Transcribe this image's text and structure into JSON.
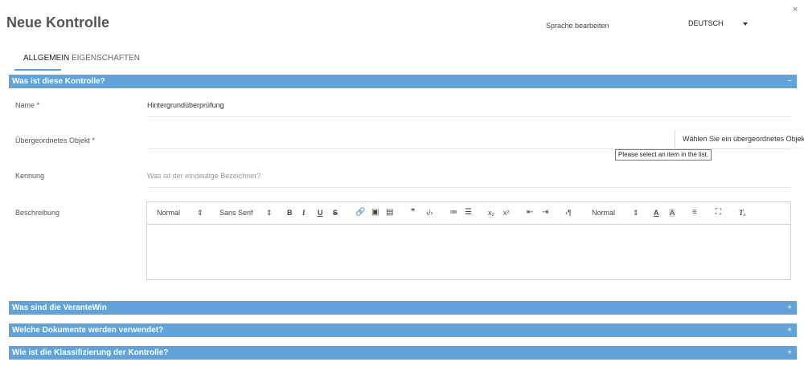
{
  "dialog": {
    "title": "Neue Kontrolle",
    "close_glyph": "×",
    "language_label": "Sprache bearbeiten",
    "language_value": "DEUTSCH"
  },
  "tabs": [
    {
      "label": "ALLGEMEIN",
      "active": true
    },
    {
      "label": "EIGENSCHAFTEN",
      "active": false
    }
  ],
  "accent_color": "#61a3d8",
  "sections": [
    {
      "title": "Was ist diese Kontrolle?",
      "toggle": "−",
      "expanded": true
    },
    {
      "title": "Was sind die VeranteWin",
      "toggle": "+",
      "expanded": false
    },
    {
      "title": "Welche Dokumente werden verwendet?",
      "toggle": "+",
      "expanded": false
    },
    {
      "title": "Wie ist die Klassifizierung der Kontrolle?",
      "toggle": "+",
      "expanded": false
    }
  ],
  "fields": {
    "name": {
      "label": "Name *",
      "value": "Hintergrundüberprüfung"
    },
    "parent": {
      "label": "Übergeordnetes Objekt *",
      "value": "",
      "tooltip": "Wählen Sie ein übergeordnetes Objekt",
      "validation": "Please select an item in the list."
    },
    "id": {
      "label": "Kennung",
      "placeholder": "Was ist der eindeutige Bezeichner?"
    },
    "description": {
      "label": "Beschreibung"
    }
  },
  "editor_toolbar": {
    "heading_select": "Normal",
    "font_select": "Sans Serif",
    "size_select": "Normal",
    "select_arrows": "⇕",
    "bold": "B",
    "italic": "I",
    "underline": "U",
    "strike": "S",
    "link_icon": "🔗",
    "image_icon": "▣",
    "video_icon": "▤",
    "blockquote_icon": "❞",
    "code_icon": "‹/›",
    "ordered_list_icon": "≔",
    "bullet_list_icon": "☰",
    "subscript": "x₂",
    "superscript": "x²",
    "outdent_icon": "⇤",
    "indent_icon": "⇥",
    "rtl_icon": "›¶",
    "color_icon": "A",
    "background_icon": "A",
    "align_icon": "≡",
    "fullscreen_icon": "⛶",
    "clean_icon": "Tₓ"
  }
}
